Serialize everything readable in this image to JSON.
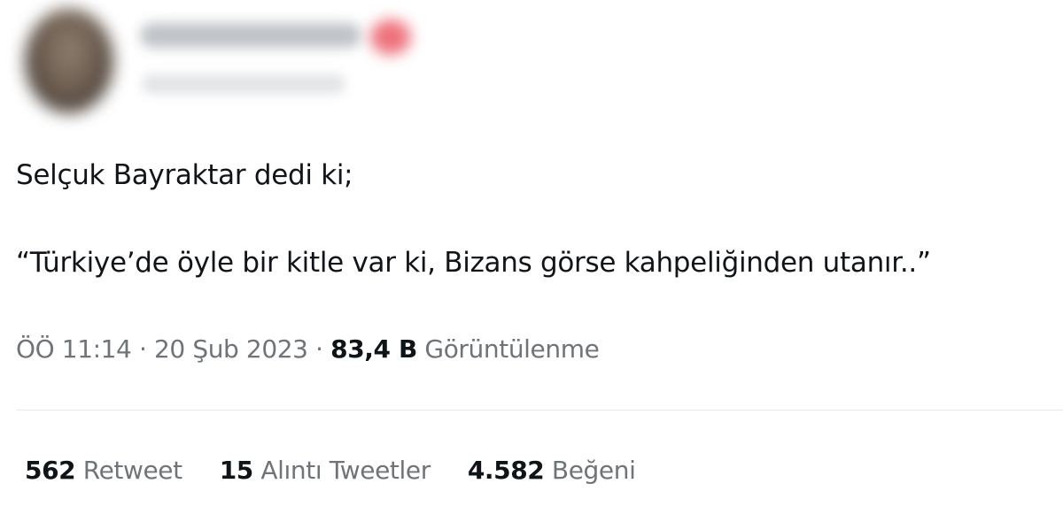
{
  "tweet": {
    "text_line1": "Selçuk Bayraktar dedi ki;",
    "text_line2": "“Türkiye’de öyle bir kitle var ki, Bizans görse kahpeliğinden utanır..”",
    "time": "ÖÖ 11:14",
    "separator": " · ",
    "date": "20 Şub 2023",
    "views_count": "83,4 B",
    "views_label": "Görüntülenme"
  },
  "stats": {
    "retweets_count": "562",
    "retweets_label": "Retweet",
    "quotes_count": "15",
    "quotes_label": "Alıntı Tweetler",
    "likes_count": "4.582",
    "likes_label": "Beğeni"
  },
  "colors": {
    "text": "#0f1419",
    "secondary": "#6f7479",
    "divider": "#e6e9ec",
    "badge": "#ea5a66"
  }
}
